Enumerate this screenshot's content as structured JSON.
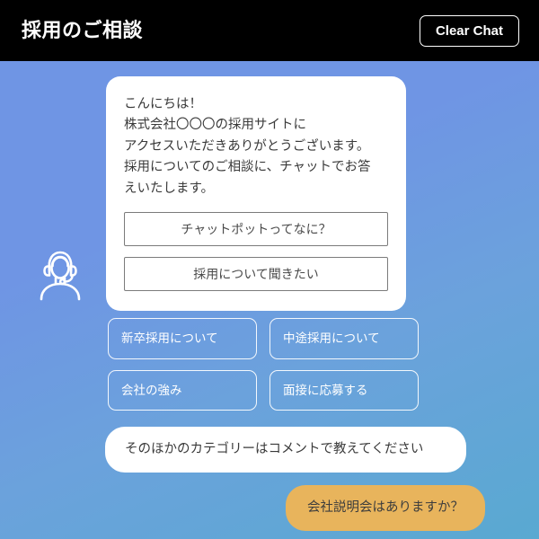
{
  "header": {
    "title": "採用のご相談",
    "clear_chat_label": "Clear Chat",
    "background_color": "#000000",
    "text_color": "#ffffff"
  },
  "theme": {
    "gradient_start": "#6f95e4",
    "gradient_end": "#59a9d1",
    "bot_bubble_bg": "#ffffff",
    "user_bubble_bg": "#e8b45c",
    "chip_border": "#ffffff",
    "inline_option_border": "#7b7b7b"
  },
  "avatar": {
    "icon": "headset-operator-icon",
    "color": "#ffffff"
  },
  "bot_message": {
    "text": "こんにちは！\n株式会社〇〇〇の採用サイトに\nアクセスいただきありがとうございます。\n採用についてのご相談に、チャットでお答\nえいたします。",
    "options": [
      {
        "label": "チャットポットってなに？"
      },
      {
        "label": "採用について聞きたい"
      }
    ]
  },
  "quick_replies": [
    {
      "label": "新卒採用について"
    },
    {
      "label": "中途採用について"
    },
    {
      "label": "会社の強み"
    },
    {
      "label": "面接に応募する"
    }
  ],
  "prompt_message": {
    "text": "そのほかのカテゴリーはコメントで教えてください"
  },
  "user_message": {
    "text": "会社説明会はありますか？"
  }
}
